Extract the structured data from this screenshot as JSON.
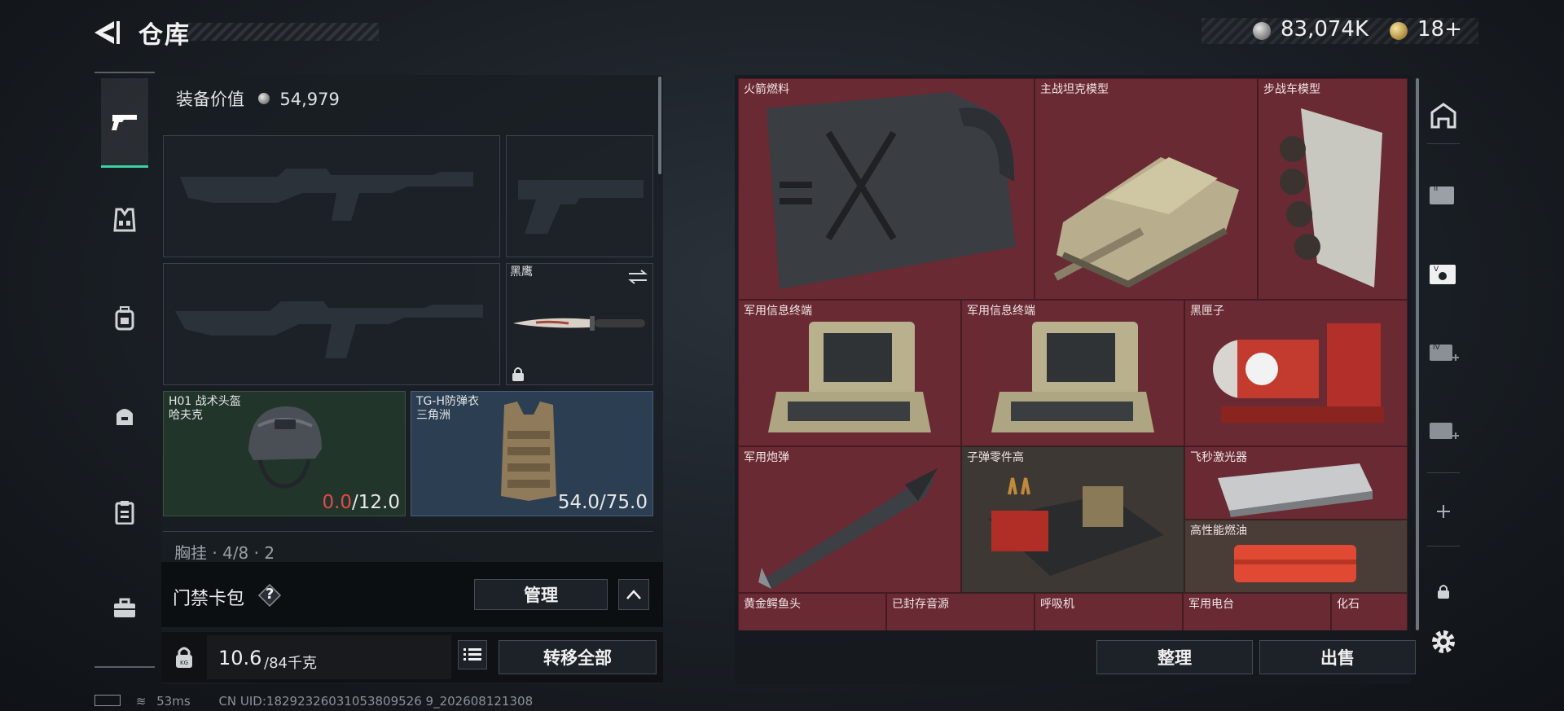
{
  "header": {
    "title": "仓库",
    "currency_silver": "83,074K",
    "currency_gold": "18+"
  },
  "rail": [
    "weapon-tab",
    "vest-tab",
    "backpack-tab",
    "pouch-tab",
    "clipboard-tab",
    "case-tab"
  ],
  "loadout": {
    "equip_value_label": "装备价值",
    "equip_value": "54,979",
    "knife_label": "黑鹰",
    "helmet": {
      "name": "H01 战术头盔",
      "sub": "哈夫克",
      "durability_current": "0.0",
      "durability_max": "/12.0"
    },
    "armor": {
      "name": "TG-H防弹衣",
      "sub": "三角洲",
      "durability": "54.0/75.0"
    },
    "chest_rig_partial": "胸挂 · 4/8 · 2"
  },
  "card_bar": {
    "label": "门禁卡包",
    "help": "?",
    "manage": "管理"
  },
  "weight": {
    "current": "10.6",
    "unit": "/84千克",
    "transfer_all": "转移全部"
  },
  "grid_items": [
    "火箭燃料",
    "主战坦克模型",
    "步战车模型",
    "军用信息终端",
    "军用信息终端",
    "黑匣子",
    "军用炮弹",
    "子弹零件高",
    "飞秒激光器",
    "高性能燃油",
    "黄金鳄鱼头",
    "已封存音源",
    "呼吸机",
    "军用电台",
    "化石"
  ],
  "actions": {
    "organize": "整理",
    "sell": "出售"
  },
  "status_bar": {
    "ping": "53ms",
    "uid": "CN UID:18292326031053809526 9_202608121308"
  },
  "colors": {
    "accent": "#38d2a4",
    "grid_red": "#6a2a33",
    "low": "#e24a4a"
  }
}
